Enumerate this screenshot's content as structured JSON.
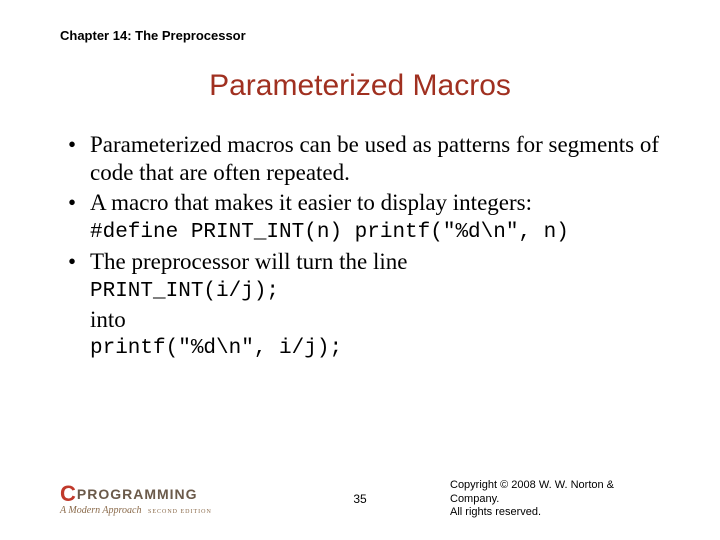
{
  "chapter": "Chapter 14: The Preprocessor",
  "title": "Parameterized Macros",
  "bullets": {
    "b1": "Parameterized macros can be used as patterns for segments of code that are often repeated.",
    "b2": "A macro that makes it easier to display integers:",
    "b3": "The preprocessor will turn the line"
  },
  "code": {
    "define": "#define PRINT_INT(n) printf(\"%d\\n\", n)",
    "call": "PRINT_INT(i/j);",
    "into": "into",
    "expanded": "printf(\"%d\\n\", i/j);"
  },
  "footer": {
    "logo_c": "C",
    "logo_prog": "PROGRAMMING",
    "logo_sub": "A Modern Approach",
    "logo_ed": "SECOND EDITION",
    "page": "35",
    "copyright": "Copyright © 2008 W. W. Norton & Company.\nAll rights reserved."
  }
}
